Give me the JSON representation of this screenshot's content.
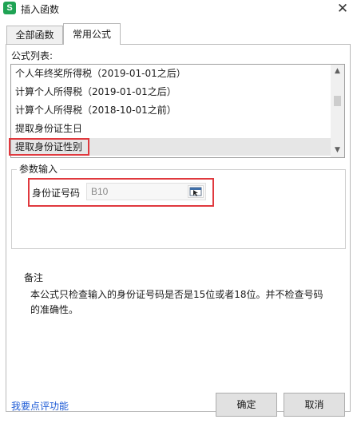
{
  "window": {
    "title": "插入函数",
    "app_icon_glyph": "S",
    "close_glyph": "✕"
  },
  "tabs": [
    {
      "label": "全部函数",
      "active": false
    },
    {
      "label": "常用公式",
      "active": true
    }
  ],
  "formula_list": {
    "label": "公式列表:",
    "items": [
      {
        "label": "个人年终奖所得税（2019-01-01之后）",
        "selected": false
      },
      {
        "label": "计算个人所得税（2019-01-01之后）",
        "selected": false
      },
      {
        "label": "计算个人所得税（2018-10-01之前）",
        "selected": false
      },
      {
        "label": "提取身份证生日",
        "selected": false
      },
      {
        "label": "提取身份证性别",
        "selected": true
      }
    ],
    "scroll_up_glyph": "▲",
    "scroll_down_glyph": "▼"
  },
  "params": {
    "legend": "参数输入",
    "id_label": "身份证号码",
    "id_value": "B10",
    "picker_icon": "cell-range-picker-icon"
  },
  "notes": {
    "title": "备注",
    "text": "本公式只检查输入的身份证号码是否是15位或者18位。并不检查号码的准确性。"
  },
  "footer": {
    "feedback_link": "我要点评功能",
    "ok_label": "确定",
    "cancel_label": "取消"
  },
  "highlight_color": "#e0393e"
}
